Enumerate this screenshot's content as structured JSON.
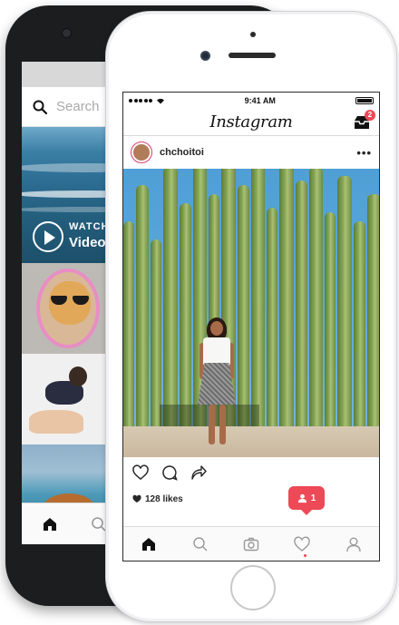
{
  "back_phone": {
    "search": {
      "placeholder": "Search",
      "icon": "search-icon"
    },
    "video_tile": {
      "watch_label": "WATCH",
      "video_label": "Video"
    },
    "tabbar": {
      "items": [
        "home-icon",
        "search-icon"
      ]
    }
  },
  "front_phone": {
    "status_bar": {
      "time": "9:41 AM"
    },
    "header": {
      "logo": "Instagram",
      "inbox_badge": "2"
    },
    "post": {
      "username": "chchoitoi",
      "more_label": "•••",
      "likes": "128 likes"
    },
    "notification": {
      "count": "1"
    },
    "tabbar": {
      "items": [
        "home-icon",
        "search-icon",
        "camera-icon",
        "heart-icon",
        "profile-icon"
      ]
    }
  },
  "colors": {
    "accent": "#ed4956",
    "text": "#262626",
    "border": "#dbdbdb"
  }
}
